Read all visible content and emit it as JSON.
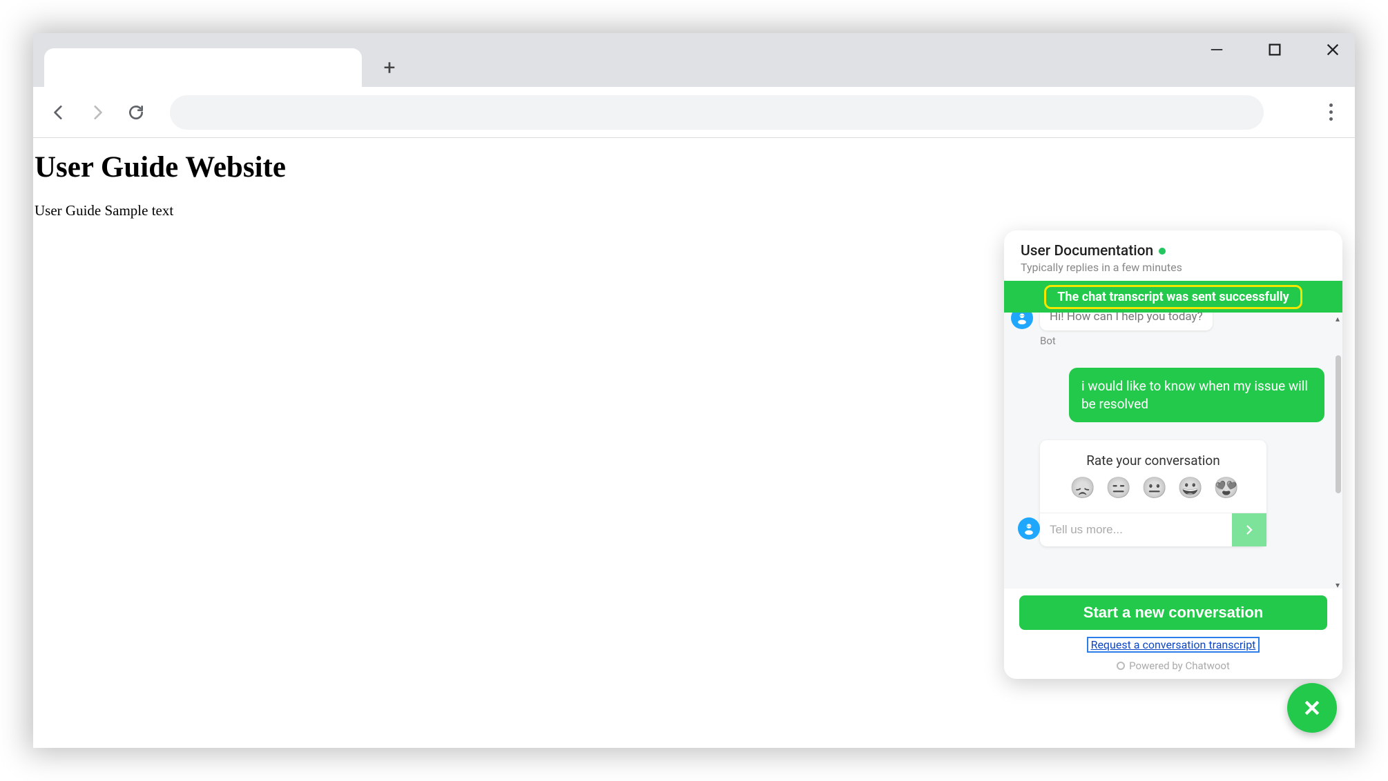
{
  "page": {
    "heading": "User Guide Website",
    "body_text": "User Guide Sample text"
  },
  "chat": {
    "title": "User Documentation",
    "subtitle": "Typically replies in a few minutes",
    "toast": "The chat transcript was sent successfully",
    "bot_bubble_partial": "Hi! How can I help you today?",
    "bot_label": "Bot",
    "user_message": "i would like to know when my issue will be resolved",
    "rating_title": "Rate your conversation",
    "rating_placeholder": "Tell us more...",
    "new_conversation": "Start a new conversation",
    "transcript_link": "Request a conversation transcript",
    "powered_by": "Powered by Chatwoot",
    "emojis": [
      "😞",
      "😑",
      "😐",
      "😀",
      "😍"
    ]
  }
}
